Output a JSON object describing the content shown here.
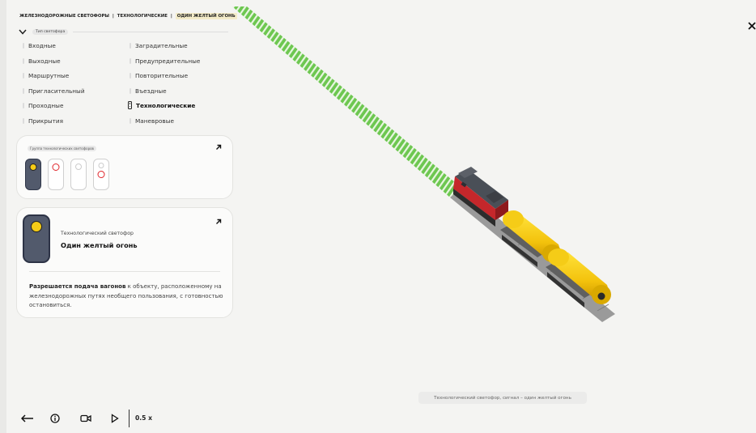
{
  "breadcrumb": {
    "part1": "ЖЕЛЕЗНОДОРОЖНЫЕ СВЕТОФОРЫ",
    "sep": "|",
    "part2": "ТЕХНОЛОГИЧЕСКИЕ",
    "part3": "ОДИН ЖЕЛТЫЙ ОГОНЬ"
  },
  "type_chip": "Тип светофора",
  "types_left": [
    "Входные",
    "Выходные",
    "Маршрутные",
    "Пригласительный",
    "Проходные",
    "Прикрытия"
  ],
  "types_right": [
    "Заградительные",
    "Предупредительные",
    "Повторительные",
    "Въездные",
    "Технологические",
    "Маневровые"
  ],
  "active_type": "Технологические",
  "groups_card": {
    "title": "Группа технологических светофоров"
  },
  "info_card": {
    "subtitle": "Технологический светофор",
    "name": "Один желтый огонь",
    "desc_bold": "Разрешается подача вагонов",
    "desc_rest": " к объекту, расположенному на железнодорожных путях необщего пользования, с готовностью остановиться."
  },
  "caption": "Технологический светофор, сигнал – один желтый огонь",
  "controls": {
    "speed": "0.5 x"
  },
  "colors": {
    "yellow": "#f5cc17",
    "red": "#e0262b",
    "signal_body": "#525a6c",
    "track_green": "#4fb935"
  },
  "icons": [
    "back-arrow-icon",
    "info-icon",
    "camera-icon",
    "play-icon",
    "close-icon",
    "chevron-down-icon",
    "diagonal-arrow-icon"
  ]
}
